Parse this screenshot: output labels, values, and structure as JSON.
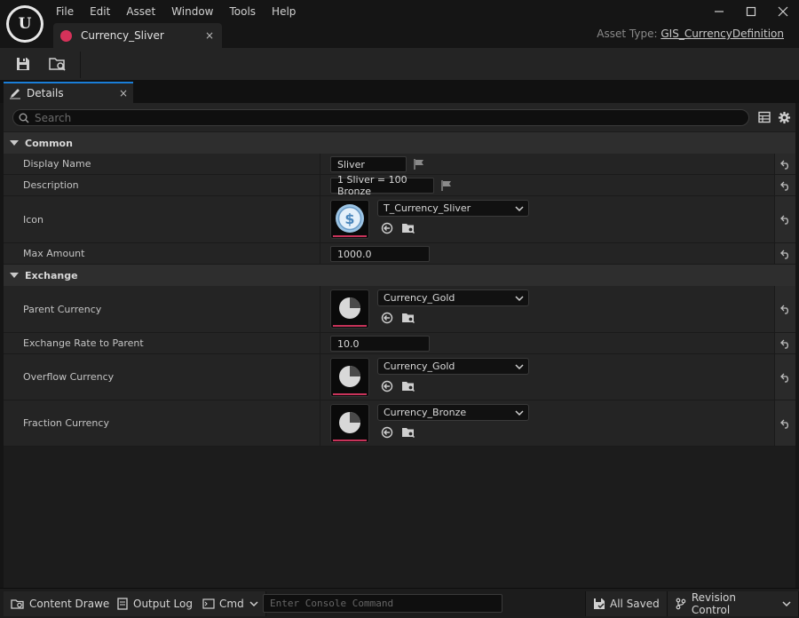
{
  "menu": [
    "File",
    "Edit",
    "Asset",
    "Window",
    "Tools",
    "Help"
  ],
  "window": {
    "minimize": "—",
    "maximize": "☐",
    "close": "✕"
  },
  "asset_tab": {
    "label": "Currency_Sliver",
    "close": "×"
  },
  "asset_type": {
    "prefix": "Asset Type:",
    "link": "GIS_CurrencyDefinition"
  },
  "details_tab": {
    "label": "Details",
    "close": "×"
  },
  "search": {
    "placeholder": "Search"
  },
  "categories": {
    "common": "Common",
    "exchange": "Exchange"
  },
  "rows": {
    "display_name": {
      "label": "Display Name",
      "value": "Sliver"
    },
    "description": {
      "label": "Description",
      "value": "1 Sliver = 100 Bronze"
    },
    "icon": {
      "label": "Icon",
      "value": "T_Currency_Sliver"
    },
    "max_amount": {
      "label": "Max Amount",
      "value": "1000.0"
    },
    "parent_currency": {
      "label": "Parent Currency",
      "value": "Currency_Gold"
    },
    "exchange_rate": {
      "label": "Exchange Rate to Parent",
      "value": "10.0"
    },
    "overflow_currency": {
      "label": "Overflow Currency",
      "value": "Currency_Gold"
    },
    "fraction_currency": {
      "label": "Fraction Currency",
      "value": "Currency_Bronze"
    }
  },
  "statusbar": {
    "content_drawer": "Content Drawer",
    "output_log": "Output Log",
    "cmd": "Cmd",
    "console_placeholder": "Enter Console Command",
    "all_saved": "All Saved",
    "revision_control": "Revision Control"
  },
  "colors": {
    "accent": "#1a7ed8",
    "thumb_bar": "#c8335a",
    "asset_dot": "#d6325a"
  }
}
